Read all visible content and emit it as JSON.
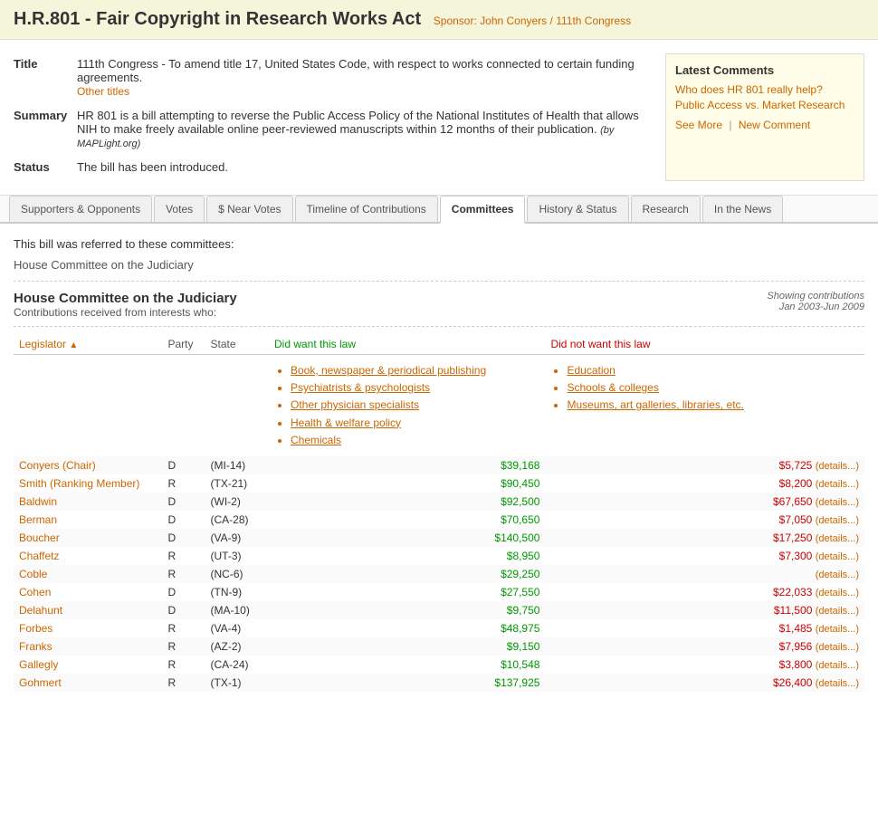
{
  "header": {
    "bill_id": "H.R.801",
    "title": "Fair Copyright in Research Works Act",
    "sponsor_label": "Sponsor:",
    "sponsor": "John Conyers",
    "congress": "111th Congress"
  },
  "bill_info": {
    "title_label": "Title",
    "title_text": "111th Congress - To amend title 17, United States Code, with respect to works connected to certain funding agreements.",
    "other_titles": "Other titles",
    "summary_label": "Summary",
    "summary_text": "HR 801 is a bill attempting to reverse the Public Access Policy of the National Institutes of Health that allows NIH to make freely available online peer-reviewed manuscripts within 12 months of their publication.",
    "summary_credit": "(by MAPLight.org)",
    "status_label": "Status",
    "status_text": "The bill has been introduced."
  },
  "latest_comments": {
    "title": "Latest Comments",
    "comment_link": "Who does HR 801 really help? Public Access vs. Market Research",
    "see_more": "See More",
    "new_comment": "New Comment"
  },
  "tabs": [
    {
      "label": "Supporters & Opponents",
      "active": false
    },
    {
      "label": "Votes",
      "active": false
    },
    {
      "label": "$ Near Votes",
      "active": false
    },
    {
      "label": "Timeline of Contributions",
      "active": false
    },
    {
      "label": "Committees",
      "active": true
    },
    {
      "label": "History & Status",
      "active": false
    },
    {
      "label": "Research",
      "active": false
    },
    {
      "label": "In the News",
      "active": false
    }
  ],
  "content": {
    "referred_text": "This bill was referred to these committees:",
    "referred_committee": "House Committee on the Judiciary",
    "committee_name": "House Committee on the Judiciary",
    "contributions_subtitle": "Contributions received from interests who:",
    "showing_label": "Showing contributions",
    "date_range": "Jan 2003-Jun 2009",
    "columns": {
      "legislator": "Legislator",
      "party": "Party",
      "state": "State",
      "did": "Did want this law",
      "didnot": "Did not want this law"
    },
    "did_interests": [
      "Book, newspaper & periodical publishing",
      "Psychiatrists & psychologists",
      "Other physician specialists",
      "Health & welfare policy",
      "Chemicals"
    ],
    "didnot_interests": [
      "Education",
      "Schools & colleges",
      "Museums, art galleries, libraries, etc."
    ],
    "legislators": [
      {
        "name": "Conyers (Chair)",
        "party": "D",
        "state": "(MI-14)",
        "did": "$39,168",
        "didnot": "$5,725"
      },
      {
        "name": "Smith (Ranking Member)",
        "party": "R",
        "state": "(TX-21)",
        "did": "$90,450",
        "didnot": "$8,200"
      },
      {
        "name": "Baldwin",
        "party": "D",
        "state": "(WI-2)",
        "did": "$92,500",
        "didnot": "$67,650"
      },
      {
        "name": "Berman",
        "party": "D",
        "state": "(CA-28)",
        "did": "$70,650",
        "didnot": "$7,050"
      },
      {
        "name": "Boucher",
        "party": "D",
        "state": "(VA-9)",
        "did": "$140,500",
        "didnot": "$17,250"
      },
      {
        "name": "Chaffetz",
        "party": "R",
        "state": "(UT-3)",
        "did": "$8,950",
        "didnot": "$7,300"
      },
      {
        "name": "Coble",
        "party": "R",
        "state": "(NC-6)",
        "did": "$29,250",
        "didnot": ""
      },
      {
        "name": "Cohen",
        "party": "D",
        "state": "(TN-9)",
        "did": "$27,550",
        "didnot": "$22,033"
      },
      {
        "name": "Delahunt",
        "party": "D",
        "state": "(MA-10)",
        "did": "$9,750",
        "didnot": "$11,500"
      },
      {
        "name": "Forbes",
        "party": "R",
        "state": "(VA-4)",
        "did": "$48,975",
        "didnot": "$1,485"
      },
      {
        "name": "Franks",
        "party": "R",
        "state": "(AZ-2)",
        "did": "$9,150",
        "didnot": "$7,956"
      },
      {
        "name": "Gallegly",
        "party": "R",
        "state": "(CA-24)",
        "did": "$10,548",
        "didnot": "$3,800"
      },
      {
        "name": "Gohmert",
        "party": "R",
        "state": "(TX-1)",
        "did": "$137,925",
        "didnot": "$26,400"
      }
    ]
  }
}
